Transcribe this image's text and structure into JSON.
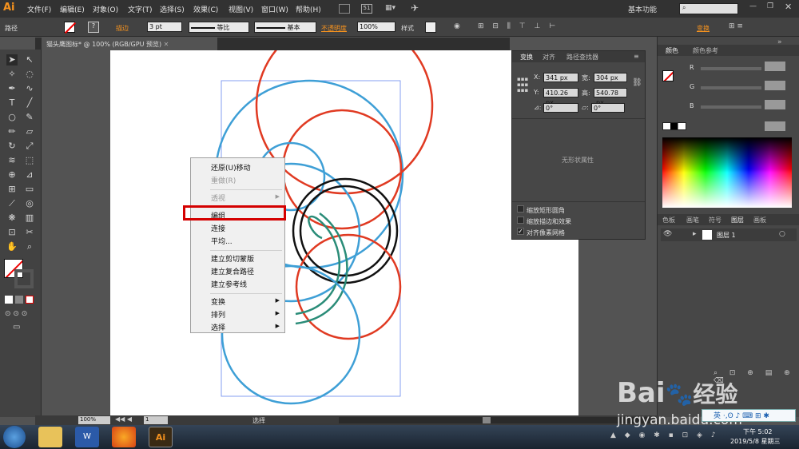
{
  "app": {
    "logo": "Ai"
  },
  "menu": [
    "文件(F)",
    "编辑(E)",
    "对象(O)",
    "文字(T)",
    "选择(S)",
    "效果(C)",
    "视图(V)",
    "窗口(W)",
    "帮助(H)"
  ],
  "workspace": "基本功能",
  "control": {
    "selection_label": "路径",
    "stroke_label": "描边",
    "stroke_value": "3 pt",
    "profile_label": "等比",
    "brush_label": "基本",
    "opacity_label": "不透明度",
    "opacity_value": "100%",
    "style_label": "样式",
    "transform_label": "变换",
    "arrange_num": "51"
  },
  "document_tab": "猫头鹰图标* @ 100% (RGB/GPU 预览)",
  "transform_panel": {
    "tabs": [
      "变换",
      "对齐",
      "路径查找器"
    ],
    "x_label": "X:",
    "x_value": "341 px",
    "w_label": "宽:",
    "w_value": "304 px",
    "y_label": "Y:",
    "y_value": "410.26 px",
    "h_label": "高:",
    "h_value": "540.78 px",
    "rotate_value": "0°",
    "shear_value": "0°",
    "no_shape": "无形状属性",
    "checks": [
      {
        "label": "缩放矩形圆角",
        "checked": false
      },
      {
        "label": "缩放描边和效果",
        "checked": false
      },
      {
        "label": "对齐像素网格",
        "checked": true
      }
    ]
  },
  "color_panel": {
    "tabs": [
      "颜色",
      "颜色参考"
    ],
    "channels": [
      "R",
      "G",
      "B"
    ]
  },
  "layers_panel": {
    "tabs": [
      "色板",
      "画笔",
      "符号",
      "图层",
      "画板"
    ],
    "layer_name": "图层 1"
  },
  "context_menu": [
    {
      "label": "还原(U)移动",
      "disabled": false,
      "submenu": false
    },
    {
      "label": "重做(R)",
      "disabled": true,
      "submenu": false
    },
    {
      "sep": true
    },
    {
      "label": "透视",
      "disabled": true,
      "submenu": true
    },
    {
      "sep": true
    },
    {
      "label": "编组",
      "disabled": false,
      "submenu": false,
      "highlighted": true
    },
    {
      "label": "连接",
      "disabled": false,
      "submenu": false
    },
    {
      "label": "平均...",
      "disabled": false,
      "submenu": false
    },
    {
      "sep": true
    },
    {
      "label": "建立剪切蒙版",
      "disabled": false,
      "submenu": false
    },
    {
      "label": "建立复合路径",
      "disabled": false,
      "submenu": false
    },
    {
      "label": "建立参考线",
      "disabled": false,
      "submenu": false
    },
    {
      "sep": true
    },
    {
      "label": "变换",
      "disabled": false,
      "submenu": true
    },
    {
      "label": "排列",
      "disabled": false,
      "submenu": true
    },
    {
      "label": "选择",
      "disabled": false,
      "submenu": true
    }
  ],
  "status": {
    "zoom": "100%",
    "page": "1",
    "tool": "选择"
  },
  "taskbar": {
    "time": "下午 5:02",
    "date": "2019/5/8 星期三",
    "ime": "英"
  },
  "watermark": {
    "brand": "Bai",
    "brand2": "经验",
    "url": "jingyan.baidu.com"
  },
  "colors": {
    "blue_circle": "#3e9fd6",
    "red_circle": "#e03a22",
    "black_circle": "#111111",
    "teal": "#2a8c78",
    "highlight": "#d40000"
  }
}
